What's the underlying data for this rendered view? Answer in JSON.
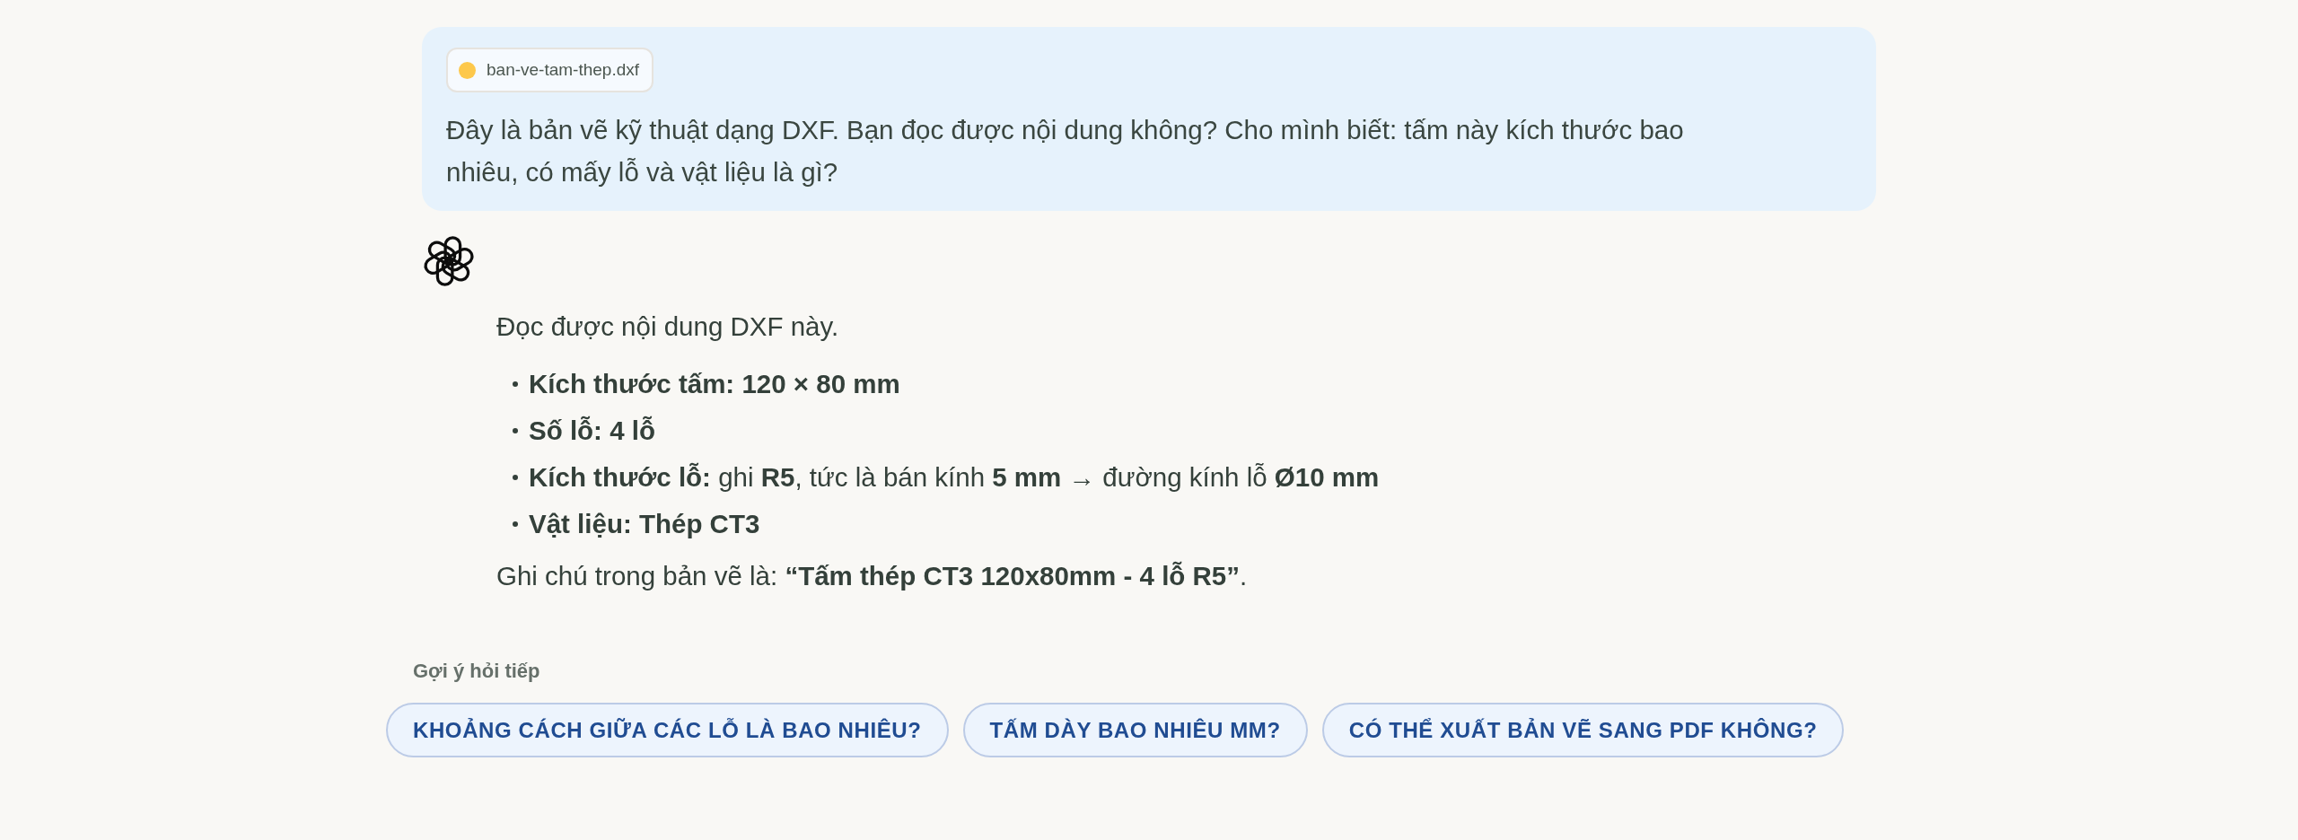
{
  "user_message": {
    "attachment": {
      "filename": "ban-ve-tam-thep.dxf"
    },
    "text": "Đây là bản vẽ kỹ thuật dạng DXF. Bạn đọc được nội dung không? Cho mình biết: tấm này kích thước bao nhiêu, có mấy lỗ và vật liệu là gì?"
  },
  "assistant_message": {
    "intro": "Đọc được nội dung DXF này.",
    "bullets": [
      {
        "label": "Kích thước tấm:",
        "value": "**120 × 80 mm**"
      },
      {
        "label": "Số lỗ:",
        "value": "**4 lỗ**"
      },
      {
        "label": "Kích thước lỗ:",
        "value": "ghi **R5**, tức là bán kính **5 mm** → đường kính lỗ **Ø10 mm**"
      },
      {
        "label": "Vật liệu:",
        "value": "**Thép CT3**"
      }
    ],
    "note": "Ghi chú trong bản vẽ là: **“Tấm thép CT3 120x80mm - 4 lỗ R5”**."
  },
  "suggestions": {
    "title": "Gợi ý hỏi tiếp",
    "items": [
      "KHOẢNG CÁCH GIỮA CÁC LỖ LÀ BAO NHIÊU?",
      "TẤM DÀY BAO NHIÊU MM?",
      "CÓ THỂ XUẤT BẢN VẼ SANG PDF KHÔNG?"
    ]
  }
}
